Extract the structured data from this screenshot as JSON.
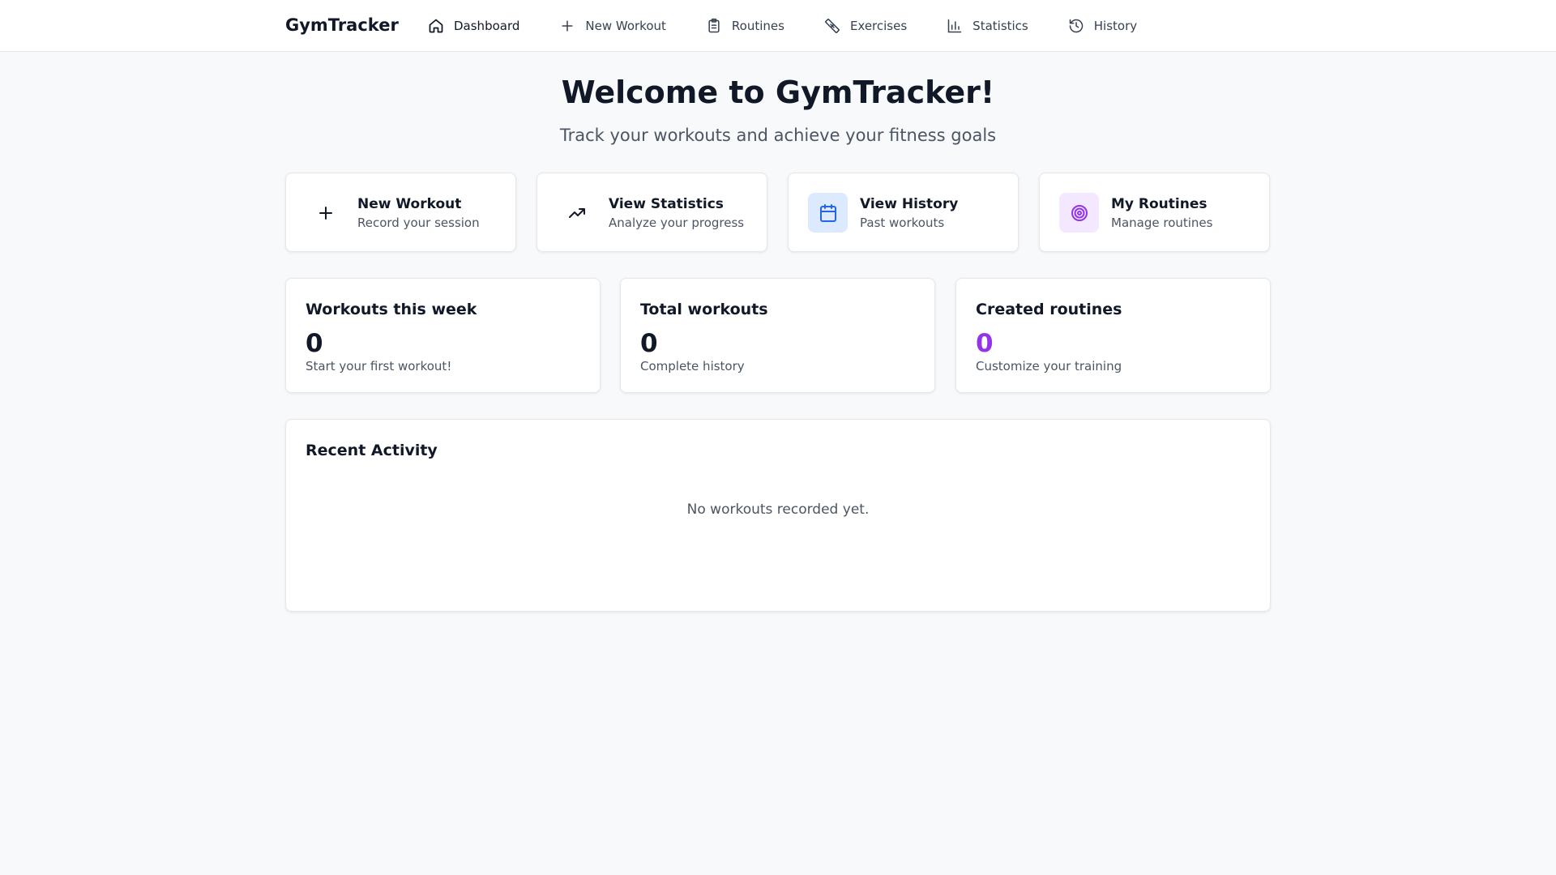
{
  "nav": {
    "brand": "GymTracker",
    "items": [
      {
        "label": "Dashboard",
        "icon": "home-icon",
        "active": true
      },
      {
        "label": "New Workout",
        "icon": "plus-icon"
      },
      {
        "label": "Routines",
        "icon": "clipboard-icon"
      },
      {
        "label": "Exercises",
        "icon": "dumbbell-icon"
      },
      {
        "label": "Statistics",
        "icon": "bar-chart-icon"
      },
      {
        "label": "History",
        "icon": "history-icon"
      }
    ]
  },
  "hero": {
    "title": "Welcome to GymTracker!",
    "subtitle": "Track your workouts and achieve your fitness goals"
  },
  "actions": [
    {
      "title": "New Workout",
      "subtitle": "Record your session",
      "icon": "plus-icon"
    },
    {
      "title": "View Statistics",
      "subtitle": "Analyze your progress",
      "icon": "trending-up-icon"
    },
    {
      "title": "View History",
      "subtitle": "Past workouts",
      "icon": "calendar-icon",
      "icon_bg": "#dbeafe",
      "icon_color": "#2563eb"
    },
    {
      "title": "My Routines",
      "subtitle": "Manage routines",
      "icon": "target-icon",
      "icon_bg": "#f3e8ff",
      "icon_color": "#9333ea"
    }
  ],
  "stats": [
    {
      "title": "Workouts this week",
      "value": "0",
      "subtitle": "Start your first workout!",
      "color": "#111827"
    },
    {
      "title": "Total workouts",
      "value": "0",
      "subtitle": "Complete history",
      "color": "#111827"
    },
    {
      "title": "Created routines",
      "value": "0",
      "subtitle": "Customize your training",
      "color": "#9333ea"
    }
  ],
  "activity": {
    "title": "Recent Activity",
    "empty_text": "No workouts recorded yet."
  }
}
